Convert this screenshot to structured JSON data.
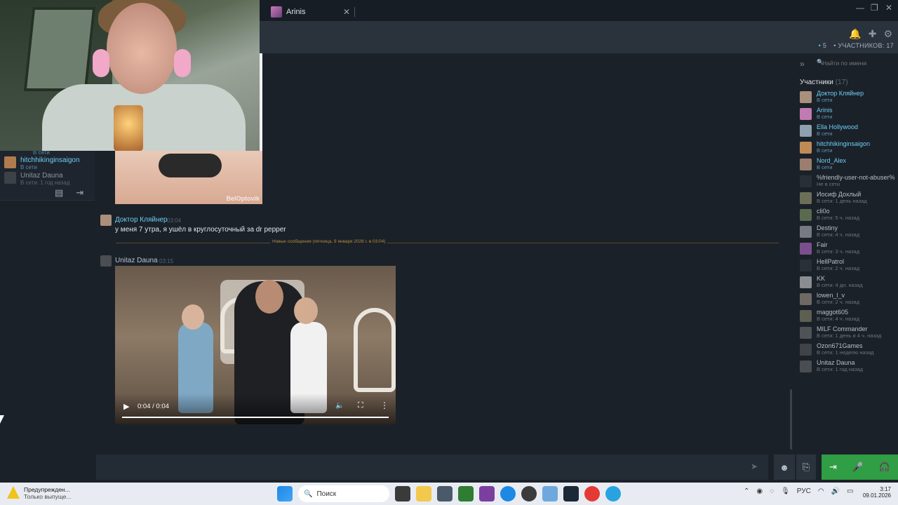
{
  "window": {
    "tab_label": "Arinis",
    "tab_close": "✕",
    "controls": {
      "minimize": "—",
      "maximize": "❐",
      "close": "✕"
    }
  },
  "header": {
    "counts": {
      "online_prefix": "•",
      "online_count": "5",
      "members_prefix": "•",
      "members_label": "УЧАСТНИКОВ: 17"
    },
    "icons": [
      "bell-icon",
      "add-user-icon",
      "settings-icon"
    ]
  },
  "left_panel": {
    "items": [
      {
        "name": "",
        "status": "В сети",
        "kind": "online"
      },
      {
        "name": "hitchhikinginsaigon",
        "status": "В сети",
        "kind": "online"
      },
      {
        "name": "Unitaz Dauna",
        "status": "В сети: 1 год назад",
        "kind": "offline"
      }
    ]
  },
  "attachment_image": {
    "watermark": "BelOptovik"
  },
  "messages": [
    {
      "author": "Доктор Кляйнер",
      "time": "03:04",
      "text": "у меня 7 утра, я ушёл в круглосуточный за dr pepper"
    },
    {
      "author": "Unitaz Dauna",
      "time": "03:15",
      "text": ""
    }
  ],
  "divider": {
    "label": "Новые сообщения (пятница, 9 января 2026 г. в 03:04)"
  },
  "video": {
    "timecode": "0:04 / 0:04",
    "progress": 1.0
  },
  "members": {
    "search_placeholder": "Найти по имени",
    "heading": "Участники",
    "heading_count": "(17)",
    "list": [
      {
        "name": "Доктор Кляйнер",
        "status": "В сети",
        "online": true,
        "color": "#a98f7c"
      },
      {
        "name": "Arinis",
        "status": "В сети",
        "online": true,
        "color": "#c27bb2"
      },
      {
        "name": "Ella Hollywood",
        "status": "В сети",
        "online": true,
        "color": "#8e9fb0"
      },
      {
        "name": "hitchhikinginsaigon",
        "status": "В сети",
        "online": true,
        "color": "#c08a56"
      },
      {
        "name": "Nord_Alex",
        "status": "В сети",
        "online": true,
        "color": "#9b7e6e"
      },
      {
        "name": "%friendly-user-not-abuser%",
        "status": "Не в сети",
        "online": false,
        "color": "#2a2f36"
      },
      {
        "name": "Иосиф Дохлый",
        "status": "В сети: 1 день назад",
        "online": false,
        "color": "#6b6f58"
      },
      {
        "name": "cli0o",
        "status": "В сети: 5 ч. назад",
        "online": false,
        "color": "#5a6a4e"
      },
      {
        "name": "Destiny",
        "status": "В сети: 4 ч. назад",
        "online": false,
        "color": "#777a80"
      },
      {
        "name": "Fair",
        "status": "В сети: 3 ч. назад",
        "online": false,
        "color": "#7b4f8e"
      },
      {
        "name": "HellPatrol",
        "status": "В сети: 2 ч. назад",
        "online": false,
        "color": "#2b3038"
      },
      {
        "name": "KK",
        "status": "В сети: 4 дн. назад",
        "online": false,
        "color": "#8a8d91"
      },
      {
        "name": "lowen_l_v",
        "status": "В сети: 2 ч. назад",
        "online": false,
        "color": "#6e6a63"
      },
      {
        "name": "maggot605",
        "status": "В сети: 4 ч. назад",
        "online": false,
        "color": "#5d5f52"
      },
      {
        "name": "MILF Commander",
        "status": "В сети: 1 день и 4 ч. назад",
        "online": false,
        "color": "#4f5357"
      },
      {
        "name": "Ozon671Games",
        "status": "В сети: 1 неделю назад",
        "online": false,
        "color": "#3f4348"
      },
      {
        "name": "Unitaz Dauna",
        "status": "В сети: 1 год назад",
        "online": false,
        "color": "#4a4e52"
      }
    ]
  },
  "composer": {
    "placeholder": "",
    "send_icon": "➤",
    "emoji_icon": "☻",
    "attach_icon": "⎘"
  },
  "voice_controls": {
    "leave_icon": "⇥",
    "mic_icon": "🎤",
    "headset_icon": "🎧"
  },
  "taskbar": {
    "warning_title": "Предупрежден...",
    "warning_sub": "Только выпуще...",
    "search_label": "Поиск",
    "lang": "РУС",
    "time": "3:17",
    "date": "09.01.2026"
  }
}
